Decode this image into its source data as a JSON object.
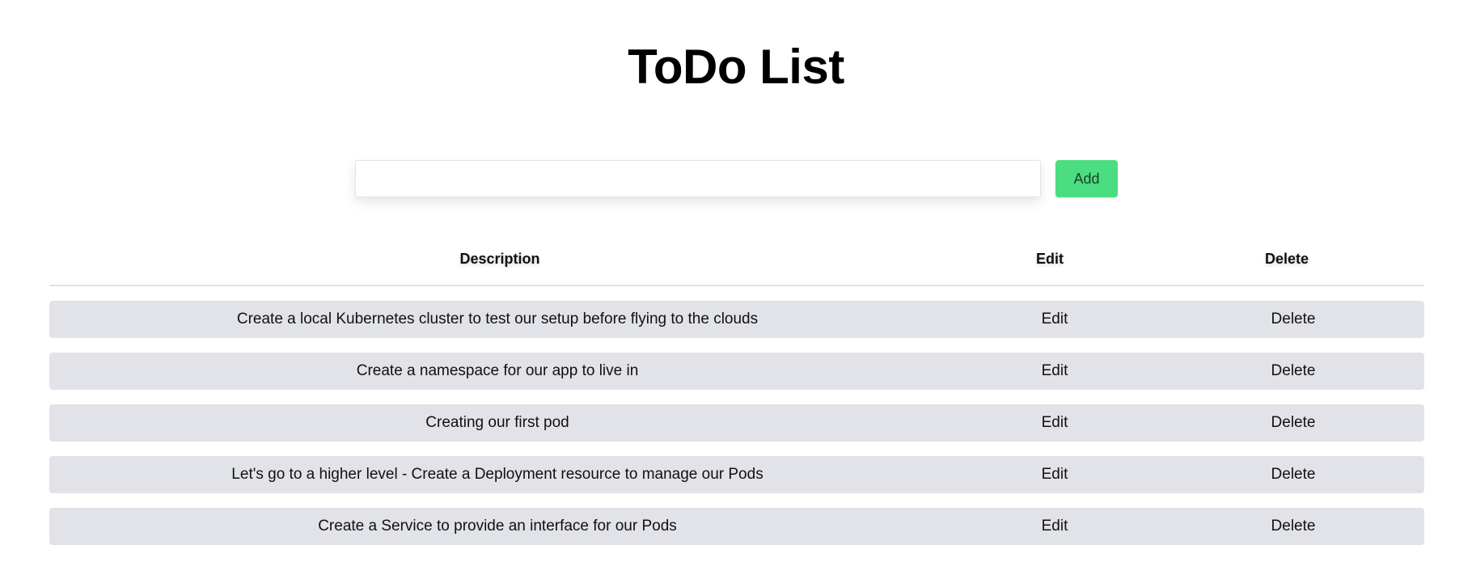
{
  "header": {
    "title": "ToDo List"
  },
  "form": {
    "input_value": "",
    "input_placeholder": "",
    "add_label": "Add"
  },
  "table": {
    "columns": {
      "description": "Description",
      "edit": "Edit",
      "delete": "Delete"
    },
    "rows": [
      {
        "description": "Create a local Kubernetes cluster to test our setup before flying to the clouds",
        "edit": "Edit",
        "delete": "Delete"
      },
      {
        "description": "Create a namespace for our app to live in",
        "edit": "Edit",
        "delete": "Delete"
      },
      {
        "description": "Creating our first pod",
        "edit": "Edit",
        "delete": "Delete"
      },
      {
        "description": "Let's go to a higher level - Create a Deployment resource to manage our Pods",
        "edit": "Edit",
        "delete": "Delete"
      },
      {
        "description": "Create a Service to provide an interface for our Pods",
        "edit": "Edit",
        "delete": "Delete"
      }
    ]
  },
  "colors": {
    "add_button": "#4ade80",
    "row_background": "#e2e3e8"
  }
}
